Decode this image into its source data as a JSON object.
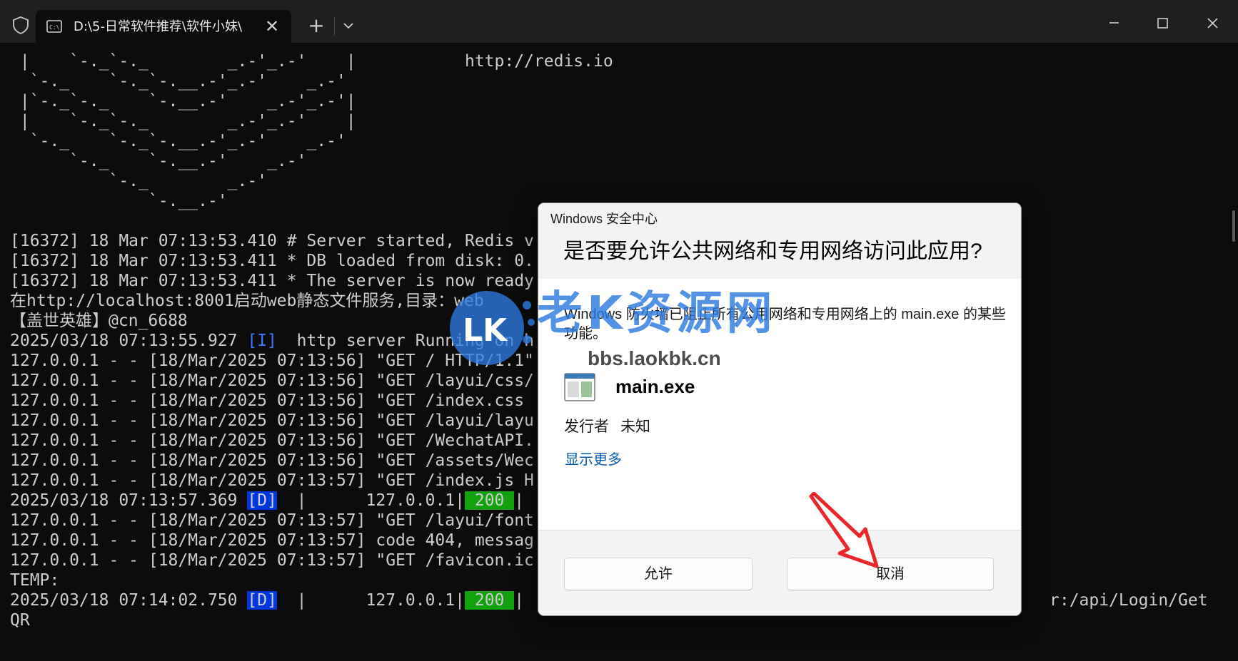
{
  "titlebar": {
    "tab_title": "D:\\5-日常软件推荐\\软件小妹\\",
    "tab_close": "✕",
    "new_tab": "+",
    "icons": {
      "shield": "shield-icon",
      "terminal": "cmd-icon",
      "dropdown": "chevron-down-icon",
      "minimize": "minimize-icon",
      "maximize": "maximize-icon",
      "close": "close-icon"
    }
  },
  "terminal": {
    "lines": [
      " |    `-._`-._        _.-'_.-'    |           http://redis.io",
      "  `-._    `-._`-.__.-'_.-'    _.-'",
      " |`-._`-._    `-.__.-'    _.-'_.-'|",
      " |    `-._`-._        _.-'_.-'    |",
      "  `-._    `-._`-.__.-'_.-'    _.-'",
      "      `-._    `-.__.-'    _.-'",
      "          `-._        _.-'",
      "              `-.__.-'",
      "",
      "[16372] 18 Mar 07:13:53.410 # Server started, Redis v",
      "[16372] 18 Mar 07:13:53.411 * DB loaded from disk: 0.",
      "[16372] 18 Mar 07:13:53.411 * The server is now ready",
      "在http://localhost:8001启动web静态文件服务,目录：web",
      "【盖世英雄】@cn_6688",
      "2025/03/18 07:13:55.927 [I]  http server Running on h",
      "127.0.0.1 - - [18/Mar/2025 07:13:56] \"GET / HTTP/1.1\"",
      "127.0.0.1 - - [18/Mar/2025 07:13:56] \"GET /layui/css/",
      "127.0.0.1 - - [18/Mar/2025 07:13:56] \"GET /index.css ",
      "127.0.0.1 - - [18/Mar/2025 07:13:56] \"GET /layui/layu",
      "127.0.0.1 - - [18/Mar/2025 07:13:56] \"GET /WechatAPI.",
      "127.0.0.1 - - [18/Mar/2025 07:13:56] \"GET /assets/Wec",
      "127.0.0.1 - - [18/Mar/2025 07:13:57] \"GET /index.js H",
      "2025/03/18 07:13:57.369 [D]  |      127.0.0.1| 200 |",
      "127.0.0.1 - - [18/Mar/2025 07:13:57] \"GET /layui/font",
      "127.0.0.1 - - [18/Mar/2025 07:13:57] code 404, messag",
      "127.0.0.1 - - [18/Mar/2025 07:13:57] \"GET /favicon.ic",
      "TEMP:",
      "2025/03/18 07:14:02.750 [D]  |      127.0.0.1| 200 |",
      "QR"
    ],
    "line_right_text": "r:/api/Login/Get"
  },
  "dialog": {
    "app_title": "Windows 安全中心",
    "title": "是否要允许公共网络和专用网络访问此应用?",
    "message": "Windows 防火墙已阻止所有公用网络和专用网络上的 main.exe 的某些功能。",
    "app_name": "main.exe",
    "publisher_label": "发行者",
    "publisher_value": "未知",
    "show_more": "显示更多",
    "allow_button": "允许",
    "cancel_button": "取消"
  },
  "watermark": {
    "main": "老K资源网",
    "site": "bbs.laokbk.cn",
    "logo": "LK"
  },
  "colors": {
    "terminal_bg": "#0c0c0c",
    "terminal_text": "#cccccc",
    "tag_blue_bg": "#0037da",
    "status_green_bg": "#13a10e",
    "link_blue": "#0b5cad",
    "arrow_red": "#e8262b"
  }
}
